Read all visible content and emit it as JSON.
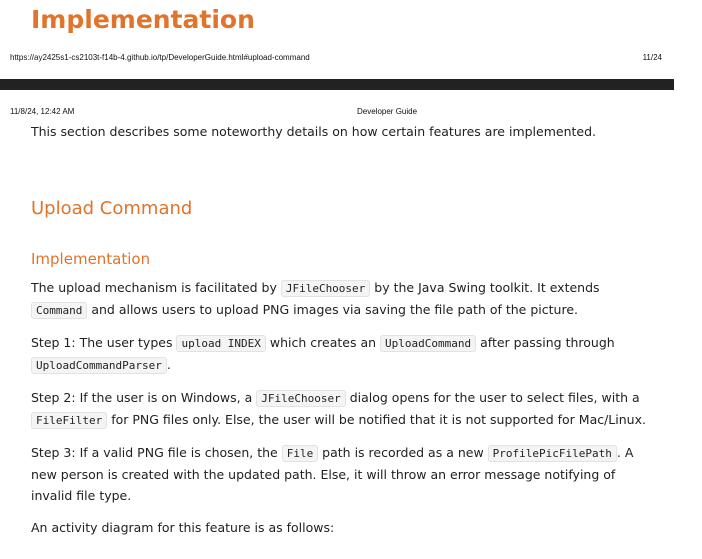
{
  "top_heading": "Implementation",
  "print_footer": {
    "url": "https://ay2425s1-cs2103t-f14b-4.github.io/tp/DeveloperGuide.html#upload-command",
    "page_count": "11/24"
  },
  "print_header": {
    "datetime": "11/8/24, 12:42 AM",
    "doc_title": "Developer Guide"
  },
  "intro": "This section describes some noteworthy details on how certain features are implemented.",
  "upload_section": {
    "title": "Upload Command",
    "subtitle": "Implementation",
    "para1": {
      "t1": "The upload mechanism is facilitated by ",
      "c1": "JFileChooser",
      "t2": " by the Java Swing toolkit. It extends ",
      "c2": "Command",
      "t3": " and allows users to upload PNG images via saving the file path of the picture."
    },
    "step1": {
      "t1": "Step 1: The user types ",
      "c1": "upload INDEX",
      "t2": " which creates an ",
      "c2": "UploadCommand",
      "t3": " after passing through ",
      "c3": "UploadCommandParser",
      "t4": "."
    },
    "step2": {
      "t1": "Step 2: If the user is on Windows, a ",
      "c1": "JFileChooser",
      "t2": " dialog opens for the user to select files, with a ",
      "c2": "FileFilter",
      "t3": " for PNG files only. Else, the user will be notified that it is not supported for Mac/Linux."
    },
    "step3": {
      "t1": "Step 3: If a valid PNG file is chosen, the ",
      "c1": "File",
      "t2": " path is recorded as a new ",
      "c2": "ProfilePicFilePath",
      "t3": ". A new person is created with the updated path. Else, it will throw an error message notifying of invalid file type."
    },
    "activity_intro": "An activity diagram for this feature is as follows:"
  }
}
